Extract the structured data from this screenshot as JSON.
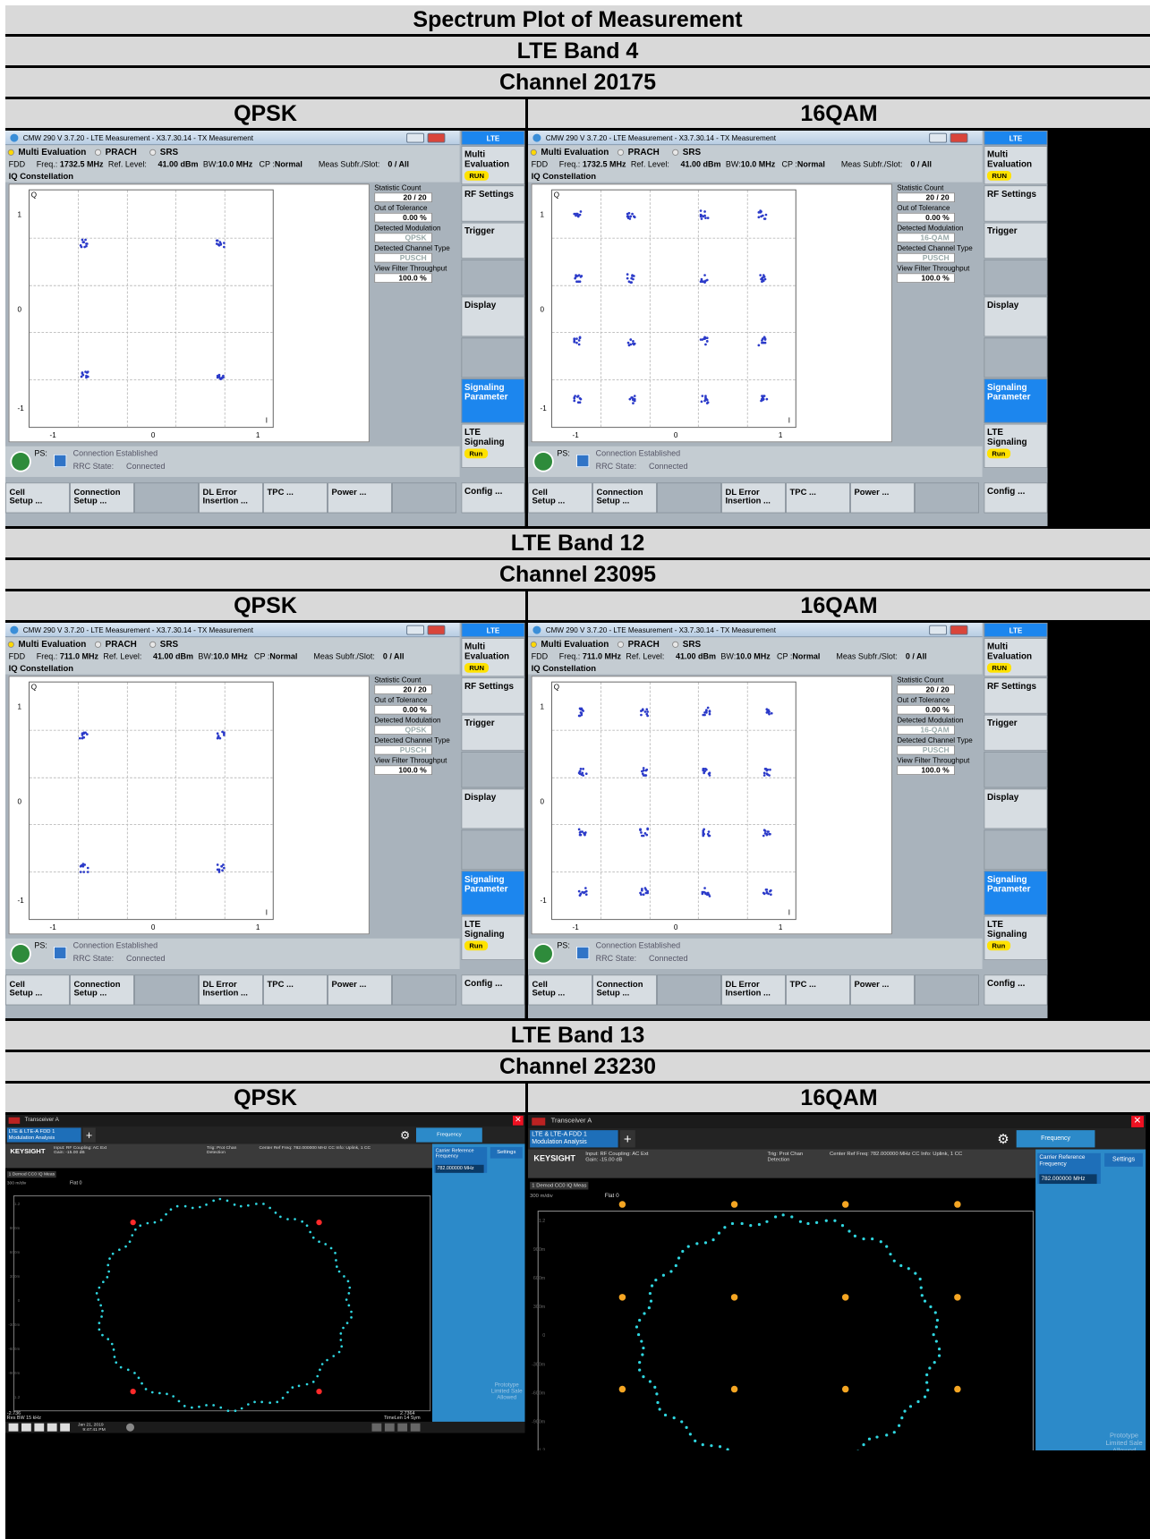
{
  "title": "Spectrum Plot of Measurement",
  "sections": [
    {
      "band": "LTE Band 4",
      "channel": "Channel 20175",
      "col_left": "QPSK",
      "col_right": "16QAM"
    },
    {
      "band": "LTE Band 12",
      "channel": "Channel 23095",
      "col_left": "QPSK",
      "col_right": "16QAM"
    },
    {
      "band": "LTE Band 13",
      "channel": "Channel 23230",
      "col_left": "QPSK",
      "col_right": "16QAM"
    }
  ],
  "cmw": {
    "window_title": "CMW 290 V 3.7.20 - LTE Measurement - X3.7.30.14 - TX Measurement",
    "tabs": [
      "Multi Evaluation",
      "PRACH",
      "SRS"
    ],
    "fdd": "FDD",
    "freq_label": "Freq.:",
    "ref_level_label": "Ref. Level:",
    "ref_level": "41.00 dBm",
    "bw_label": "BW:",
    "bw": "10.0 MHz",
    "cp_label": "CP :",
    "cp": "Normal",
    "meas_label": "Meas Subfr./Slot:",
    "meas_val": "0 / All",
    "section_title": "IQ Constellation",
    "y_axis_name": "Q",
    "x_axis_name": "I",
    "y_ticks": [
      "1",
      "0",
      "-1"
    ],
    "x_ticks": [
      "-1",
      "0",
      "1"
    ],
    "stat_count_label": "Statistic Count",
    "stat_count": "20 / 20",
    "oot_label": "Out of Tolerance",
    "oot": "0.00 %",
    "det_mod_label": "Detected Modulation",
    "det_chan_label": "Detected Channel Type",
    "det_chan": "PUSCH",
    "vft_label": "View Filter Throughput",
    "vft": "100.0 %",
    "ps_label": "PS:",
    "conn_status": "Connection Established",
    "rrc_label": "RRC State:",
    "rrc_value": "Connected",
    "softkeys": [
      "Cell\nSetup ...",
      "Connection\nSetup ...",
      "",
      "DL Error\nInsertion ...",
      "TPC ...",
      "Power ...",
      "",
      "Config ..."
    ],
    "side": {
      "lte": "LTE",
      "multi_eval": "Multi Evaluation",
      "run": "RUN",
      "rf_settings": "RF Settings",
      "trigger": "Trigger",
      "display": "Display",
      "signaling_param": "Signaling Parameter",
      "lte_signaling": "LTE Signaling",
      "run2": "Run"
    }
  },
  "panels": [
    {
      "id": "b4q",
      "freq": "1732.5 MHz",
      "det_mod": "QPSK",
      "points": [
        [
          -0.7,
          0.7
        ],
        [
          0.7,
          0.7
        ],
        [
          -0.7,
          -0.7
        ],
        [
          0.7,
          -0.7
        ]
      ]
    },
    {
      "id": "b4x",
      "freq": "1732.5 MHz",
      "det_mod": "16-QAM",
      "points": [
        [
          -1,
          1
        ],
        [
          -0.45,
          1
        ],
        [
          0.3,
          1
        ],
        [
          0.9,
          1
        ],
        [
          -1,
          0.33
        ],
        [
          -0.45,
          0.33
        ],
        [
          0.3,
          0.33
        ],
        [
          0.9,
          0.33
        ],
        [
          -1,
          -0.33
        ],
        [
          -0.45,
          -0.33
        ],
        [
          0.3,
          -0.33
        ],
        [
          0.9,
          -0.33
        ],
        [
          -1,
          -0.95
        ],
        [
          -0.45,
          -0.95
        ],
        [
          0.3,
          -0.95
        ],
        [
          0.9,
          -0.95
        ]
      ]
    },
    {
      "id": "b12q",
      "freq": "711.0 MHz",
      "det_mod": "QPSK",
      "points": [
        [
          -0.7,
          0.7
        ],
        [
          0.7,
          0.7
        ],
        [
          -0.7,
          -0.7
        ],
        [
          0.7,
          -0.7
        ]
      ]
    },
    {
      "id": "b12x",
      "freq": "711.0 MHz",
      "det_mod": "16-QAM",
      "points": [
        [
          -0.95,
          0.95
        ],
        [
          -0.32,
          0.95
        ],
        [
          0.32,
          0.95
        ],
        [
          0.95,
          0.95
        ],
        [
          -0.95,
          0.32
        ],
        [
          -0.32,
          0.32
        ],
        [
          0.32,
          0.32
        ],
        [
          0.95,
          0.32
        ],
        [
          -0.95,
          -0.32
        ],
        [
          -0.32,
          -0.32
        ],
        [
          0.32,
          -0.32
        ],
        [
          0.95,
          -0.32
        ],
        [
          -0.95,
          -0.95
        ],
        [
          -0.32,
          -0.95
        ],
        [
          0.32,
          -0.95
        ],
        [
          0.95,
          -0.95
        ]
      ]
    }
  ],
  "ks": {
    "window_title": "Transceiver A",
    "mode": "LTE & LTE-A FDD 1 Modulation Analysis",
    "logo": "KEYSIGHT",
    "input": "Input: RF Coupling: AC Ext Gain: -15.00 dB",
    "trig": "Trig: Prot Chan Detection",
    "center": "Center Ref Freq: 782.000000 MHz CC Info: Uplink, 1 CC",
    "freq_tab": "Frequency",
    "crf_label": "Carrier Reference Frequency",
    "crf_value": "782.000000 MHz",
    "settings": "Settings",
    "trace_label": "1 Demod CC0 IQ Meas",
    "scale": "300 m/div",
    "flat": "Flat 0",
    "left_val": "-2.736",
    "res_bw": "Res BW 15 kHz",
    "right_val": "2.7364",
    "time_len": "TimeLen 14 Sym",
    "date": "Jan 21, 2019",
    "time_left": "9:47:41 PM",
    "time_right": "9:46:53 PM",
    "proto": "Prototype Limited Sale Allowed",
    "y_ticks": [
      "1.2",
      "900m",
      "600m",
      "300m",
      "0",
      "-300m",
      "-600m",
      "-900m",
      "-1.2"
    ]
  }
}
